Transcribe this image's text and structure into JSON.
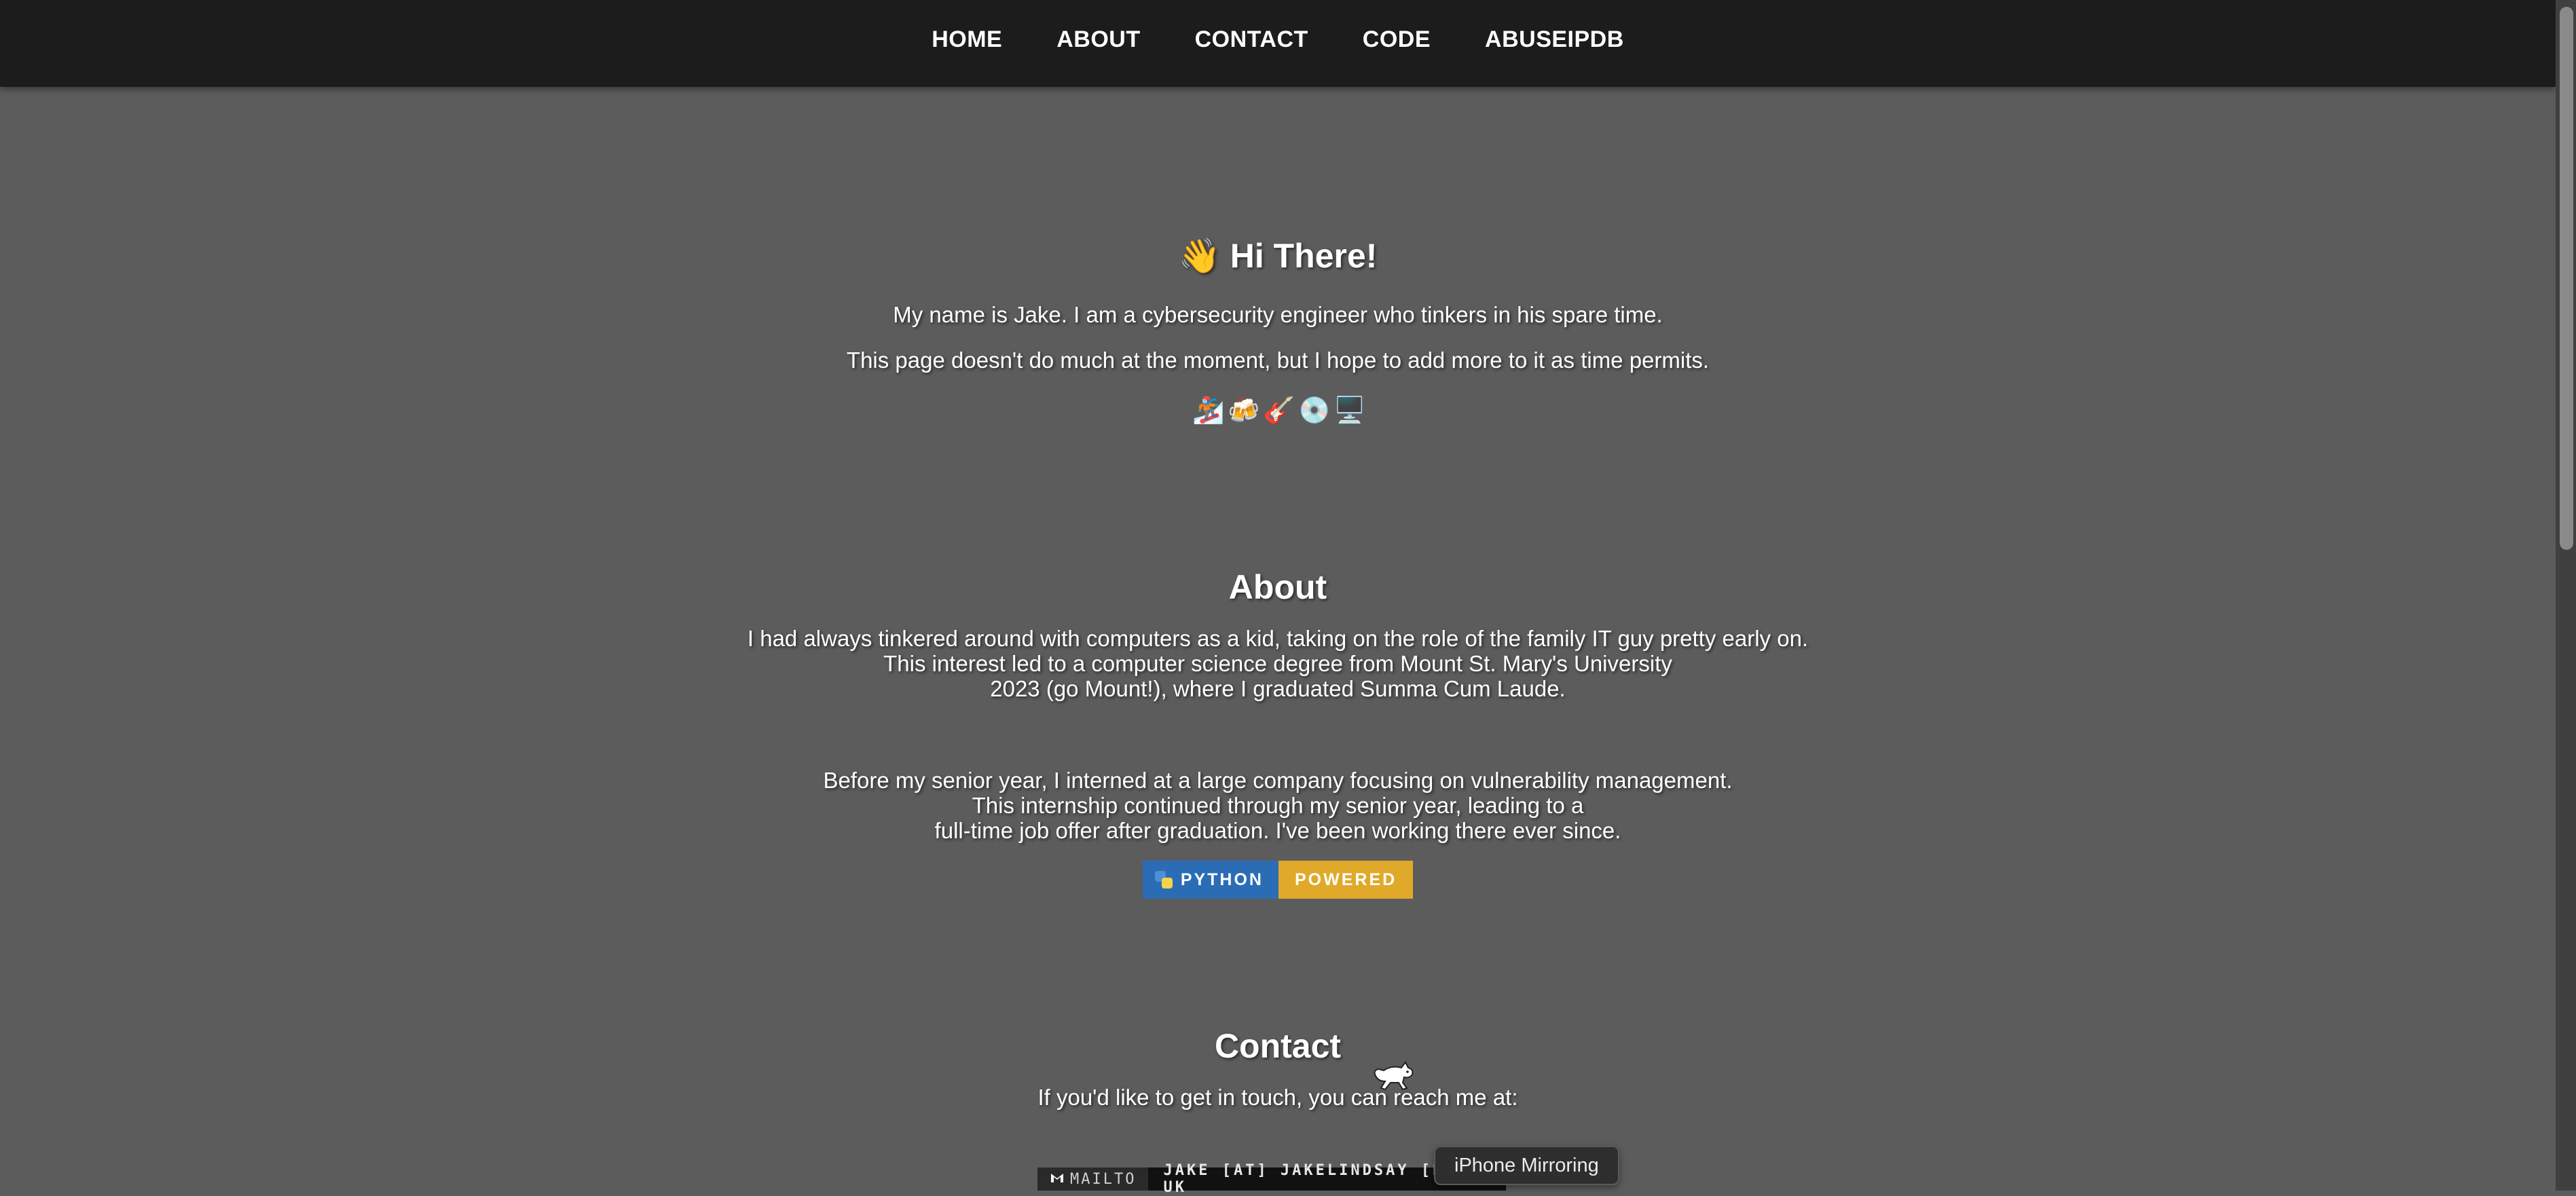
{
  "nav": {
    "items": [
      {
        "label": "HOME"
      },
      {
        "label": "ABOUT"
      },
      {
        "label": "CONTACT"
      },
      {
        "label": "CODE"
      },
      {
        "label": "ABUSEIPDB"
      }
    ]
  },
  "intro": {
    "wave": "👋",
    "heading": "Hi There!",
    "line1": "My name is Jake. I am a cybersecurity engineer who tinkers in his spare time.",
    "line2": "This page doesn't do much at the moment, but I hope to add more to it as time permits.",
    "emojis": [
      "🏂",
      "🍻",
      "🎸",
      "💿",
      "🖥️"
    ]
  },
  "about": {
    "heading": "About",
    "para1": [
      "I had always tinkered around with computers as a kid, taking on the role of the family IT guy pretty early on.",
      "This interest led to a computer science degree from Mount St. Mary's University",
      "2023 (go Mount!), where I graduated Summa Cum Laude."
    ],
    "para2": [
      "Before my senior year, I interned at a large company focusing on vulnerability management.",
      "This internship continued through my senior year, leading to a",
      "full-time job offer after graduation. I've been working there ever since."
    ],
    "badge": {
      "left": "PYTHON",
      "right": "POWERED",
      "left_color": "#2a6db5",
      "right_color": "#e0a92a"
    }
  },
  "contact": {
    "heading": "Contact",
    "text": "If you'd like to get in touch, you can reach me at:",
    "mailto_label": "MAILTO",
    "mailto_address": "JAKE [AT] JAKELINDSAY [DOT] UK"
  },
  "tooltip": {
    "text": "iPhone Mirroring"
  },
  "colors": {
    "background": "#5c5c5c",
    "navbar": "#1c1c1c"
  }
}
